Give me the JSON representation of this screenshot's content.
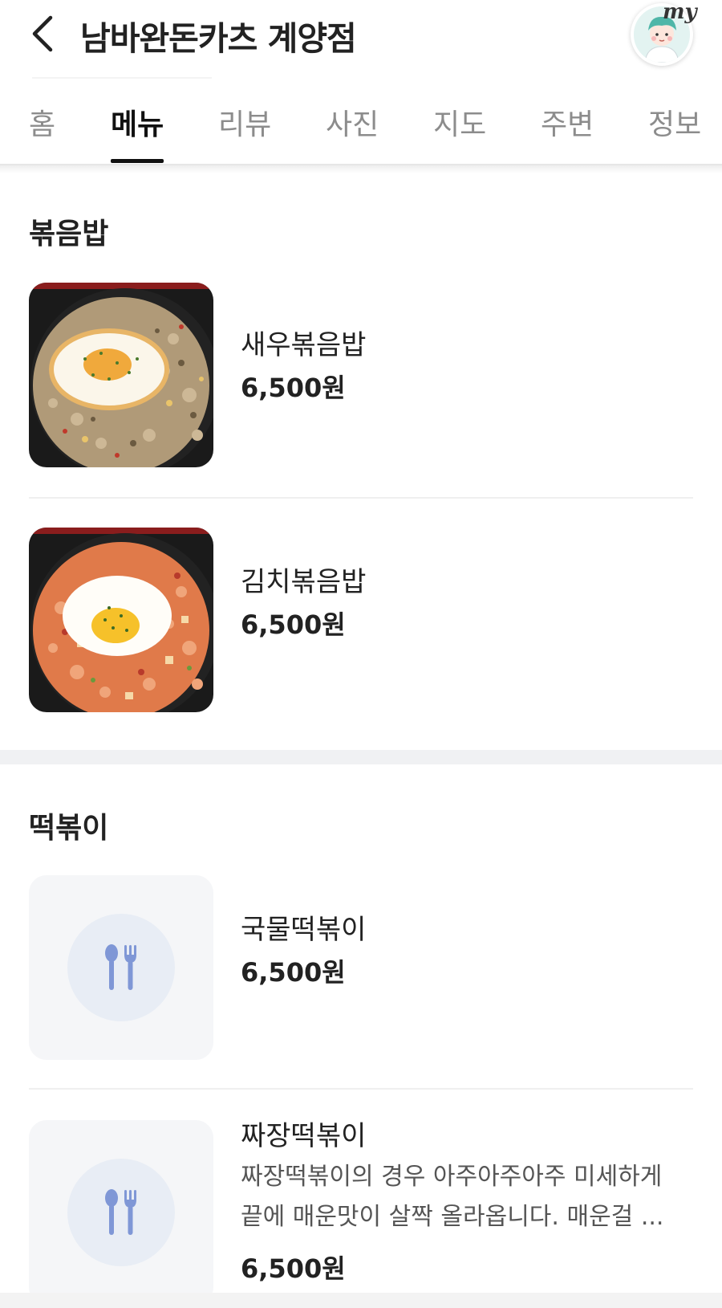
{
  "header": {
    "title": "남바완돈카츠 계양점",
    "my_label": "my"
  },
  "tabs": [
    {
      "label": "홈"
    },
    {
      "label": "메뉴"
    },
    {
      "label": "리뷰"
    },
    {
      "label": "사진"
    },
    {
      "label": "지도"
    },
    {
      "label": "주변"
    },
    {
      "label": "정보"
    }
  ],
  "active_tab": "메뉴",
  "sections": [
    {
      "title": "볶음밥",
      "items": [
        {
          "name": "새우볶음밥",
          "price": "6,500원",
          "image": "shrimp-fried-rice-photo"
        },
        {
          "name": "김치볶음밥",
          "price": "6,500원",
          "image": "kimchi-fried-rice-photo"
        }
      ]
    },
    {
      "title": "떡볶이",
      "items": [
        {
          "name": "국물떡볶이",
          "price": "6,500원",
          "image": "utensils-placeholder-icon"
        },
        {
          "name": "짜장떡볶이",
          "price": "6,500원",
          "image": "utensils-placeholder-icon",
          "description_line1": "짜장떡볶이의 경우 아주아주아주 미세하게",
          "description_line2": "끝에 매운맛이 살짝 올라옵니다. 매운걸 ..."
        }
      ]
    }
  ],
  "colors": {
    "active_tab": "#111111",
    "inactive_tab": "#8c8c8c",
    "placeholder_bg": "#f5f6f8",
    "utensil_icon": "#7f97d6"
  }
}
